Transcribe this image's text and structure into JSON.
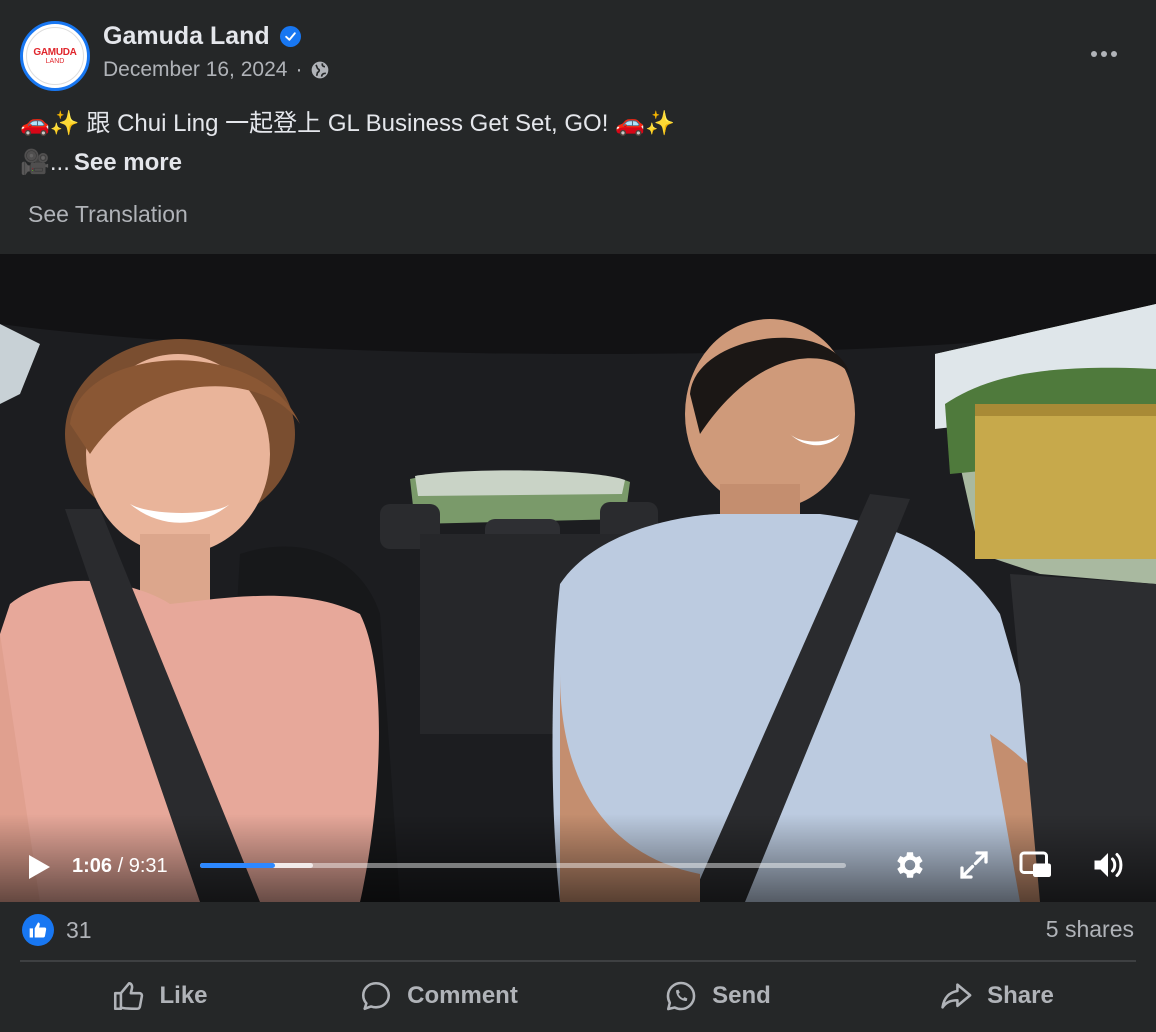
{
  "post": {
    "author": "Gamuda Land",
    "logo_text_top": "GAMUDA",
    "logo_text_bottom": "LAND",
    "date": "December 16, 2024",
    "separator": "·",
    "caption": "🚗✨ 跟 Chui Ling 一起登上 GL Business Get Set, GO!  🚗✨",
    "caption_line2_prefix": "🎥...",
    "see_more": "See more",
    "see_translation": "See Translation"
  },
  "video": {
    "current_time": "1:06",
    "time_separator": " / ",
    "duration": "9:31",
    "progress_fraction": 0.116
  },
  "footer": {
    "reaction_count": "31",
    "shares": "5 shares"
  },
  "actions": {
    "like": "Like",
    "comment": "Comment",
    "send": "Send",
    "share": "Share"
  },
  "colors": {
    "accent": "#1877f2",
    "background": "#252728",
    "progress": "#2d88ff"
  }
}
